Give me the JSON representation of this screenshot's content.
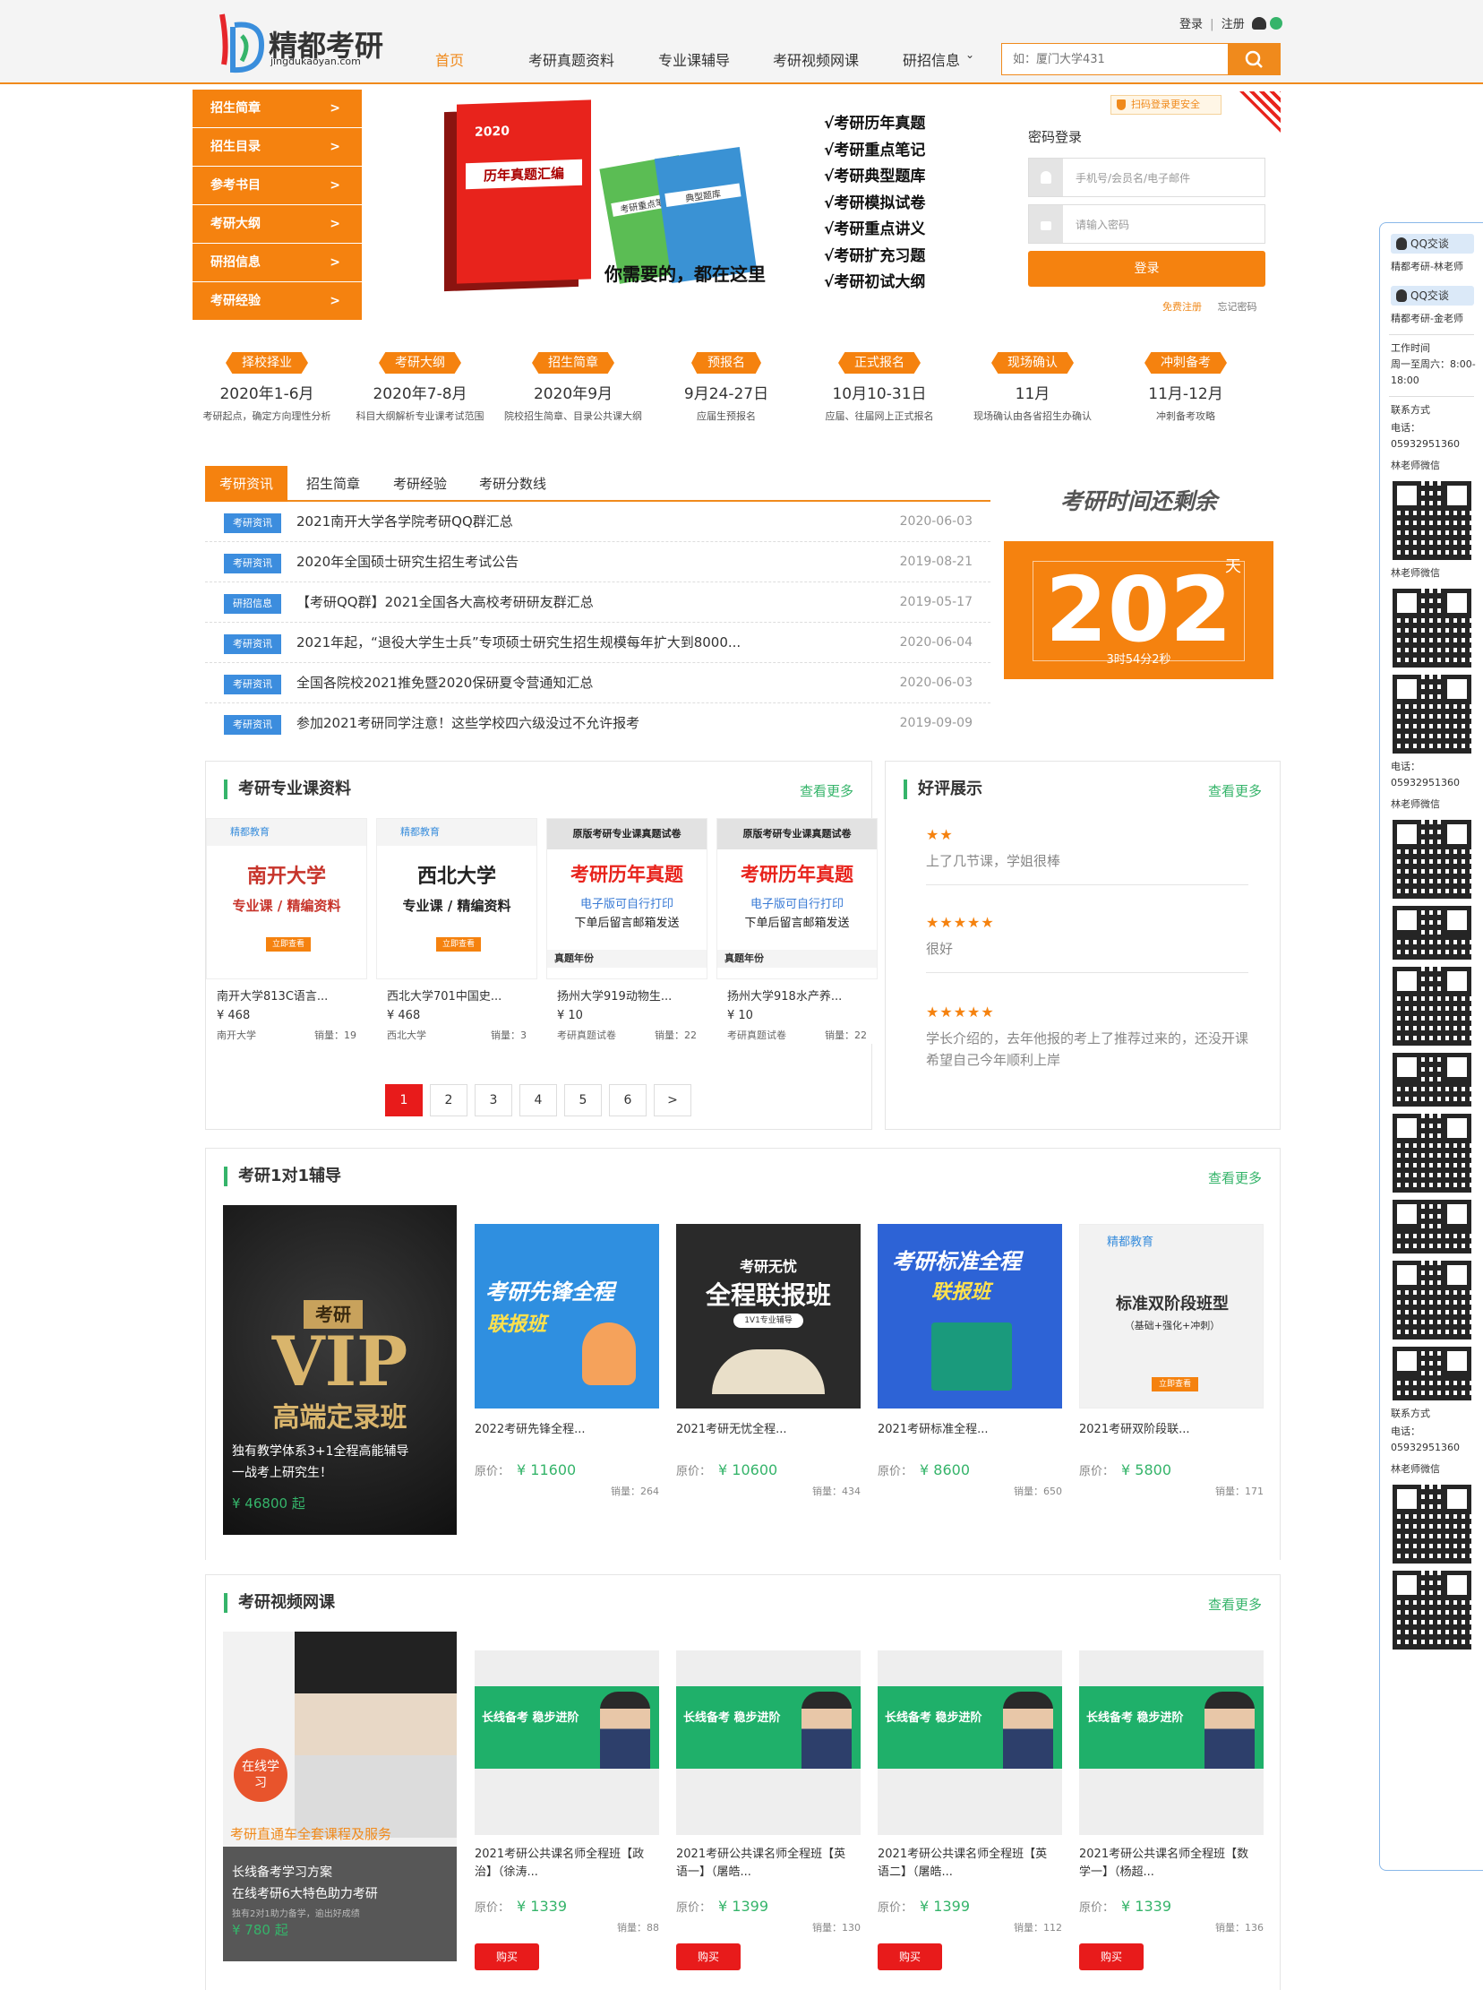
{
  "header": {
    "logo_name": "精都考研",
    "logo_sub": "jingdukaoyan.com",
    "nav": [
      "首页",
      "考研真题资料",
      "专业课辅导",
      "考研视频网课",
      "研招信息"
    ],
    "top_links": {
      "login": "登录",
      "sep": "|",
      "register": "注册"
    },
    "search_placeholder": "如：厦门大学431",
    "icons": [
      "user-icon",
      "weixin-icon",
      "search-icon",
      "chevron-down-icon"
    ]
  },
  "sidemenu": [
    "招生简章",
    "招生目录",
    "参考书目",
    "考研大纲",
    "研招信息",
    "考研经验"
  ],
  "banner": {
    "book1_title": "历年真题汇编",
    "book1_year": "2020",
    "book2_title": "考研重点笔记",
    "book3_title": "典型题库",
    "list": [
      "√考研历年真题",
      "√考研重点笔记",
      "√考研典型题库",
      "√考研模拟试卷",
      "√考研重点讲义",
      "√考研扩充习题",
      "√考研初试大纲"
    ],
    "slogan": "你需要的，都在这里"
  },
  "login": {
    "scan_tip": "扫码登录更安全",
    "title": "密码登录",
    "user_ph": "手机号/会员名/电子邮件",
    "pwd_ph": "请输入密码",
    "btn": "登录",
    "free_register": "免费注册",
    "forgot": "忘记密码"
  },
  "timeline": [
    {
      "tag": "择校择业",
      "date": "2020年1-6月",
      "desc": "考研起点，确定方向理性分析"
    },
    {
      "tag": "考研大纲",
      "date": "2020年7-8月",
      "desc": "科目大纲解析专业课考试范围"
    },
    {
      "tag": "招生简章",
      "date": "2020年9月",
      "desc": "院校招生简章、目录公共课大纲"
    },
    {
      "tag": "预报名",
      "date": "9月24-27日",
      "desc": "应届生预报名"
    },
    {
      "tag": "正式报名",
      "date": "10月10-31日",
      "desc": "应届、往届网上正式报名"
    },
    {
      "tag": "现场确认",
      "date": "11月",
      "desc": "现场确认由各省招生办确认"
    },
    {
      "tag": "冲刺备考",
      "date": "11月-12月",
      "desc": "冲刺备考攻略"
    }
  ],
  "news": {
    "tabs": [
      "考研资讯",
      "招生简章",
      "考研经验",
      "考研分数线"
    ],
    "rows": [
      {
        "tag": "考研资讯",
        "title": "2021南开大学各学院考研QQ群汇总",
        "date": "2020-06-03"
      },
      {
        "tag": "考研资讯",
        "title": "2020年全国硕士研究生招生考试公告",
        "date": "2019-08-21"
      },
      {
        "tag": "研招信息",
        "title": "【考研QQ群】2021全国各大高校考研研友群汇总",
        "date": "2019-05-17"
      },
      {
        "tag": "考研资讯",
        "title": "2021年起，“退役大学生士兵”专项硕士研究生招生规模每年扩大到8000...",
        "date": "2020-06-04"
      },
      {
        "tag": "考研资讯",
        "title": "全国各院校2021推免暨2020保研夏令营通知汇总",
        "date": "2020-06-03"
      },
      {
        "tag": "考研资讯",
        "title": "参加2021考研同学注意！这些学校四六级没过不允许报考",
        "date": "2019-09-09"
      }
    ]
  },
  "countdown": {
    "title": "考研时间还剩余",
    "days": "202",
    "unit": "天",
    "sub": "3时54分2秒"
  },
  "materials": {
    "title": "考研专业课资料",
    "more": "查看更多",
    "items": [
      {
        "img_head": "精都教育",
        "img_main": "南开大学",
        "img_sub": "专业课 / 精编资料",
        "img_btn": "立即查看",
        "name": "南开大学813C语言...",
        "price": "¥ 468",
        "school": "南开大学",
        "sales_label": "销量：",
        "sales": "19"
      },
      {
        "img_head": "精都教育",
        "img_main": "西北大学",
        "img_sub": "专业课 / 精编资料",
        "img_btn": "立即查看",
        "name": "西北大学701中国史...",
        "price": "¥ 468",
        "school": "西北大学",
        "sales_label": "销量：",
        "sales": "3"
      },
      {
        "img_head": "原版考研专业课真题试卷",
        "img_main": "考研历年真题",
        "img_sub": "电子版可自行打印",
        "img_sub2": "下单后留言邮箱发送",
        "img_btn": "真题年份",
        "name": "扬州大学919动物生...",
        "price": "¥ 10",
        "school": "考研真题试卷",
        "sales_label": "销量：",
        "sales": "22"
      },
      {
        "img_head": "原版考研专业课真题试卷",
        "img_main": "考研历年真题",
        "img_sub": "电子版可自行打印",
        "img_sub2": "下单后留言邮箱发送",
        "img_btn": "真题年份",
        "name": "扬州大学918水产养...",
        "price": "¥ 10",
        "school": "考研真题试卷",
        "sales_label": "销量：",
        "sales": "22"
      }
    ],
    "pages": [
      "1",
      "2",
      "3",
      "4",
      "5",
      "6",
      ">"
    ]
  },
  "reviews": {
    "title": "好评展示",
    "more": "查看更多",
    "items": [
      {
        "stars": "★★",
        "text": "上了几节课，学姐很棒"
      },
      {
        "stars": "★★★★★",
        "text": "很好"
      },
      {
        "stars": "★★★★★",
        "text": "学长介绍的，去年他报的考上了推荐过来的，还没开课希望自己今年顺利上岸"
      }
    ]
  },
  "tutoring": {
    "title": "考研1对1辅导",
    "more": "查看更多",
    "vip": {
      "badge": "考研",
      "big": "VIP",
      "name": "高端定录班",
      "desc1": "独有教学体系3+1全程高能辅导",
      "desc2": "一战考上研究生！",
      "price": "¥ 46800 起"
    },
    "price_label": "原价：",
    "sales_label": "销量：",
    "cards": [
      {
        "img_t1": "考研先锋全程",
        "img_t2": "联报班",
        "name": "2022考研先锋全程...",
        "price": "¥ 11600",
        "sales": "264"
      },
      {
        "img_t1": "考研无忧",
        "img_t2": "全程联报班",
        "img_t3": "1V1专业辅导",
        "name": "2021考研无忧全程...",
        "price": "¥ 10600",
        "sales": "434"
      },
      {
        "img_t1": "考研标准全程",
        "img_t2": "联报班",
        "name": "2021考研标准全程...",
        "price": "¥ 8600",
        "sales": "650"
      },
      {
        "img_t1": "精都教育",
        "img_t2": "标准双阶段班型",
        "img_t3": "（基础+强化+冲刺）",
        "img_btn": "立即查看",
        "name": "2021考研双阶段联...",
        "price": "¥ 5800",
        "sales": "171"
      }
    ]
  },
  "video": {
    "title": "考研视频网课",
    "more": "查看更多",
    "feature": {
      "badge": "在线学习",
      "head": "考研直通车全套课程及服务",
      "line1": "长线备考学习方案",
      "line2": "在线考研6大特色助力考研",
      "line3": "独有2对1助力备学，逾出好成绩",
      "price": "¥ 780 起"
    },
    "price_label": "原价：",
    "sales_label": "销量：",
    "buy": "购买",
    "banner_text": "长线备考 稳步进阶",
    "cards": [
      {
        "name1": "2021考研公共课名师全程班【政",
        "name2": "治】（徐涛...",
        "price": "¥ 1339",
        "sales": "88"
      },
      {
        "name1": "2021考研公共课名师全程班【英",
        "name2": "语一】（屠皓...",
        "price": "¥ 1399",
        "sales": "130"
      },
      {
        "name1": "2021考研公共课名师全程班【英",
        "name2": "语二】（屠皓...",
        "price": "¥ 1399",
        "sales": "112"
      },
      {
        "name1": "2021考研公共课名师全程班【数",
        "name2": "学一】（杨超...",
        "price": "¥ 1339",
        "sales": "136"
      }
    ]
  },
  "floatbar": {
    "qq": "QQ交谈",
    "contact1": "精都考研-林老师",
    "contact2": "精都考研-金老师",
    "work_label": "工作时间",
    "work_time": "周一至周六：8:00-18:00",
    "contact_label": "联系方式",
    "phone_label": "电话：",
    "phone": "05932951360",
    "wechat": "林老师微信"
  },
  "colors": {
    "accent": "#f5820f",
    "green": "#35b46a",
    "blue_tag": "#3c8dde",
    "red": "#e81b1b"
  }
}
